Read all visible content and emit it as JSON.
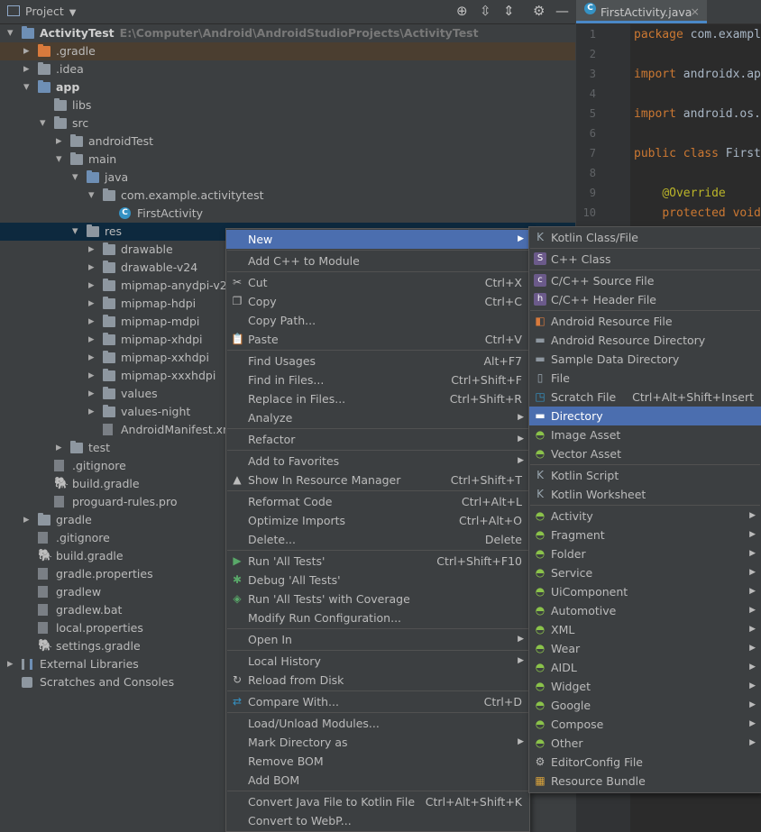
{
  "project_panel": {
    "title": "Project"
  },
  "editor": {
    "tab_label": "FirstActivity.java",
    "lines": [
      {
        "num": "1",
        "pre": "",
        "kw": "package",
        "rest": " com.exampl"
      },
      {
        "num": "2",
        "pre": "",
        "kw": "",
        "rest": ""
      },
      {
        "num": "3",
        "pre": "",
        "kw": "import",
        "rest": " androidx.ap"
      },
      {
        "num": "4",
        "pre": "",
        "kw": "",
        "rest": ""
      },
      {
        "num": "5",
        "pre": "",
        "kw": "import",
        "rest": " android.os."
      },
      {
        "num": "6",
        "pre": "",
        "kw": "",
        "rest": ""
      },
      {
        "num": "7",
        "pre": "",
        "kw": "public class",
        "rest": " First"
      },
      {
        "num": "8",
        "pre": "",
        "kw": "",
        "rest": ""
      },
      {
        "num": "9",
        "pre": "    ",
        "ann": "@Override",
        "kw": "",
        "rest": ""
      },
      {
        "num": "10",
        "pre": "    ",
        "kw": "protected void",
        "rest": ""
      }
    ]
  },
  "tree": [
    {
      "label": "ActivityTest",
      "path": "E:\\Computer\\Android\\AndroidStudioProjects\\ActivityTest",
      "depth": 0,
      "arrow": "down",
      "icon": "folder-blue",
      "bold": true
    },
    {
      "label": ".gradle",
      "depth": 1,
      "arrow": "right",
      "icon": "folder-orange",
      "highlight": true
    },
    {
      "label": ".idea",
      "depth": 1,
      "arrow": "right",
      "icon": "folder"
    },
    {
      "label": "app",
      "depth": 1,
      "arrow": "down",
      "icon": "folder-blue",
      "bold": true
    },
    {
      "label": "libs",
      "depth": 2,
      "arrow": "",
      "icon": "folder"
    },
    {
      "label": "src",
      "depth": 2,
      "arrow": "down",
      "icon": "folder"
    },
    {
      "label": "androidTest",
      "depth": 3,
      "arrow": "right",
      "icon": "folder"
    },
    {
      "label": "main",
      "depth": 3,
      "arrow": "down",
      "icon": "folder"
    },
    {
      "label": "java",
      "depth": 4,
      "arrow": "down",
      "icon": "folder-blue"
    },
    {
      "label": "com.example.activitytest",
      "depth": 5,
      "arrow": "down",
      "icon": "folder"
    },
    {
      "label": "FirstActivity",
      "depth": 6,
      "arrow": "",
      "icon": "class"
    },
    {
      "label": "res",
      "depth": 4,
      "arrow": "down",
      "icon": "folder",
      "selected": true
    },
    {
      "label": "drawable",
      "depth": 5,
      "arrow": "right",
      "icon": "folder"
    },
    {
      "label": "drawable-v24",
      "depth": 5,
      "arrow": "right",
      "icon": "folder"
    },
    {
      "label": "mipmap-anydpi-v26",
      "depth": 5,
      "arrow": "right",
      "icon": "folder"
    },
    {
      "label": "mipmap-hdpi",
      "depth": 5,
      "arrow": "right",
      "icon": "folder"
    },
    {
      "label": "mipmap-mdpi",
      "depth": 5,
      "arrow": "right",
      "icon": "folder"
    },
    {
      "label": "mipmap-xhdpi",
      "depth": 5,
      "arrow": "right",
      "icon": "folder"
    },
    {
      "label": "mipmap-xxhdpi",
      "depth": 5,
      "arrow": "right",
      "icon": "folder"
    },
    {
      "label": "mipmap-xxxhdpi",
      "depth": 5,
      "arrow": "right",
      "icon": "folder"
    },
    {
      "label": "values",
      "depth": 5,
      "arrow": "right",
      "icon": "folder"
    },
    {
      "label": "values-night",
      "depth": 5,
      "arrow": "right",
      "icon": "folder"
    },
    {
      "label": "AndroidManifest.xml",
      "depth": 5,
      "arrow": "",
      "icon": "file"
    },
    {
      "label": "test",
      "depth": 3,
      "arrow": "right",
      "icon": "folder"
    },
    {
      "label": ".gitignore",
      "depth": 2,
      "arrow": "",
      "icon": "file"
    },
    {
      "label": "build.gradle",
      "depth": 2,
      "arrow": "",
      "icon": "gradle"
    },
    {
      "label": "proguard-rules.pro",
      "depth": 2,
      "arrow": "",
      "icon": "file"
    },
    {
      "label": "gradle",
      "depth": 1,
      "arrow": "right",
      "icon": "folder"
    },
    {
      "label": ".gitignore",
      "depth": 1,
      "arrow": "",
      "icon": "file"
    },
    {
      "label": "build.gradle",
      "depth": 1,
      "arrow": "",
      "icon": "gradle"
    },
    {
      "label": "gradle.properties",
      "depth": 1,
      "arrow": "",
      "icon": "file"
    },
    {
      "label": "gradlew",
      "depth": 1,
      "arrow": "",
      "icon": "file"
    },
    {
      "label": "gradlew.bat",
      "depth": 1,
      "arrow": "",
      "icon": "file"
    },
    {
      "label": "local.properties",
      "depth": 1,
      "arrow": "",
      "icon": "file"
    },
    {
      "label": "settings.gradle",
      "depth": 1,
      "arrow": "",
      "icon": "gradle"
    },
    {
      "label": "External Libraries",
      "depth": 0,
      "arrow": "right",
      "icon": "library"
    },
    {
      "label": "Scratches and Consoles",
      "depth": 0,
      "arrow": "",
      "icon": "scratch"
    }
  ],
  "context_menu": {
    "items": [
      {
        "label": "New",
        "shortcut": "",
        "submenu": true,
        "active": true,
        "icon": ""
      },
      {
        "sep": true
      },
      {
        "label": "Add C++ to Module",
        "shortcut": "",
        "icon": ""
      },
      {
        "sep": true
      },
      {
        "label": "Cut",
        "shortcut": "Ctrl+X",
        "icon": "scissors-icon"
      },
      {
        "label": "Copy",
        "shortcut": "Ctrl+C",
        "icon": "copy-icon"
      },
      {
        "label": "Copy Path...",
        "shortcut": "",
        "icon": ""
      },
      {
        "label": "Paste",
        "shortcut": "Ctrl+V",
        "icon": "paste-icon"
      },
      {
        "sep": true
      },
      {
        "label": "Find Usages",
        "shortcut": "Alt+F7",
        "icon": ""
      },
      {
        "label": "Find in Files...",
        "shortcut": "Ctrl+Shift+F",
        "icon": ""
      },
      {
        "label": "Replace in Files...",
        "shortcut": "Ctrl+Shift+R",
        "icon": ""
      },
      {
        "label": "Analyze",
        "shortcut": "",
        "submenu": true,
        "icon": ""
      },
      {
        "sep": true
      },
      {
        "label": "Refactor",
        "shortcut": "",
        "submenu": true,
        "icon": ""
      },
      {
        "sep": true
      },
      {
        "label": "Add to Favorites",
        "shortcut": "",
        "submenu": true,
        "icon": ""
      },
      {
        "label": "Show In Resource Manager",
        "shortcut": "Ctrl+Shift+T",
        "icon": "resource-manager-icon"
      },
      {
        "sep": true
      },
      {
        "label": "Reformat Code",
        "shortcut": "Ctrl+Alt+L",
        "icon": ""
      },
      {
        "label": "Optimize Imports",
        "shortcut": "Ctrl+Alt+O",
        "icon": ""
      },
      {
        "label": "Delete...",
        "shortcut": "Delete",
        "icon": ""
      },
      {
        "sep": true
      },
      {
        "label": "Run 'All Tests'",
        "shortcut": "Ctrl+Shift+F10",
        "icon": "run-icon"
      },
      {
        "label": "Debug 'All Tests'",
        "shortcut": "",
        "icon": "debug-icon"
      },
      {
        "label": "Run 'All Tests' with Coverage",
        "shortcut": "",
        "icon": "coverage-icon"
      },
      {
        "label": "Modify Run Configuration...",
        "shortcut": "",
        "icon": ""
      },
      {
        "sep": true
      },
      {
        "label": "Open In",
        "shortcut": "",
        "submenu": true,
        "icon": ""
      },
      {
        "sep": true
      },
      {
        "label": "Local History",
        "shortcut": "",
        "submenu": true,
        "icon": ""
      },
      {
        "label": "Reload from Disk",
        "shortcut": "",
        "icon": "reload-icon"
      },
      {
        "sep": true
      },
      {
        "label": "Compare With...",
        "shortcut": "Ctrl+D",
        "icon": "compare-icon"
      },
      {
        "sep": true
      },
      {
        "label": "Load/Unload Modules...",
        "shortcut": "",
        "icon": ""
      },
      {
        "label": "Mark Directory as",
        "shortcut": "",
        "submenu": true,
        "icon": ""
      },
      {
        "label": "Remove BOM",
        "shortcut": "",
        "icon": ""
      },
      {
        "label": "Add BOM",
        "shortcut": "",
        "icon": ""
      },
      {
        "sep": true
      },
      {
        "label": "Convert Java File to Kotlin File",
        "shortcut": "Ctrl+Alt+Shift+K",
        "icon": ""
      },
      {
        "label": "Convert to WebP...",
        "shortcut": "",
        "icon": ""
      }
    ]
  },
  "new_submenu": {
    "items": [
      {
        "label": "Kotlin Class/File",
        "shortcut": "",
        "icon": "kotlin-file-icon"
      },
      {
        "sep": true
      },
      {
        "label": "C++ Class",
        "shortcut": "",
        "icon": "cpp-class-icon"
      },
      {
        "sep": true
      },
      {
        "label": "C/C++ Source File",
        "shortcut": "",
        "icon": "cpp-source-icon"
      },
      {
        "label": "C/C++ Header File",
        "shortcut": "",
        "icon": "cpp-header-icon"
      },
      {
        "sep": true
      },
      {
        "label": "Android Resource File",
        "shortcut": "",
        "icon": "android-resource-file-icon"
      },
      {
        "label": "Android Resource Directory",
        "shortcut": "",
        "icon": "folder-icon"
      },
      {
        "label": "Sample Data Directory",
        "shortcut": "",
        "icon": "folder-icon"
      },
      {
        "label": "File",
        "shortcut": "",
        "icon": "file-icon"
      },
      {
        "label": "Scratch File",
        "shortcut": "Ctrl+Alt+Shift+Insert",
        "icon": "scratch-file-icon"
      },
      {
        "label": "Directory",
        "shortcut": "",
        "icon": "folder-icon",
        "active": true
      },
      {
        "label": "Image Asset",
        "shortcut": "",
        "icon": "android-icon"
      },
      {
        "label": "Vector Asset",
        "shortcut": "",
        "icon": "android-icon"
      },
      {
        "sep": true
      },
      {
        "label": "Kotlin Script",
        "shortcut": "",
        "icon": "kotlin-script-icon"
      },
      {
        "label": "Kotlin Worksheet",
        "shortcut": "",
        "icon": "kotlin-worksheet-icon"
      },
      {
        "sep": true
      },
      {
        "label": "Activity",
        "submenu": true,
        "icon": "android-icon"
      },
      {
        "label": "Fragment",
        "submenu": true,
        "icon": "android-icon"
      },
      {
        "label": "Folder",
        "submenu": true,
        "icon": "android-icon"
      },
      {
        "label": "Service",
        "submenu": true,
        "icon": "android-icon"
      },
      {
        "label": "UiComponent",
        "submenu": true,
        "icon": "android-icon"
      },
      {
        "label": "Automotive",
        "submenu": true,
        "icon": "android-icon"
      },
      {
        "label": "XML",
        "submenu": true,
        "icon": "android-icon"
      },
      {
        "label": "Wear",
        "submenu": true,
        "icon": "android-icon"
      },
      {
        "label": "AIDL",
        "submenu": true,
        "icon": "android-icon"
      },
      {
        "label": "Widget",
        "submenu": true,
        "icon": "android-icon"
      },
      {
        "label": "Google",
        "submenu": true,
        "icon": "android-icon"
      },
      {
        "label": "Compose",
        "submenu": true,
        "icon": "android-icon"
      },
      {
        "label": "Other",
        "submenu": true,
        "icon": "android-icon"
      },
      {
        "label": "EditorConfig File",
        "shortcut": "",
        "icon": "editorconfig-icon"
      },
      {
        "label": "Resource Bundle",
        "shortcut": "",
        "icon": "resource-bundle-icon"
      }
    ]
  }
}
